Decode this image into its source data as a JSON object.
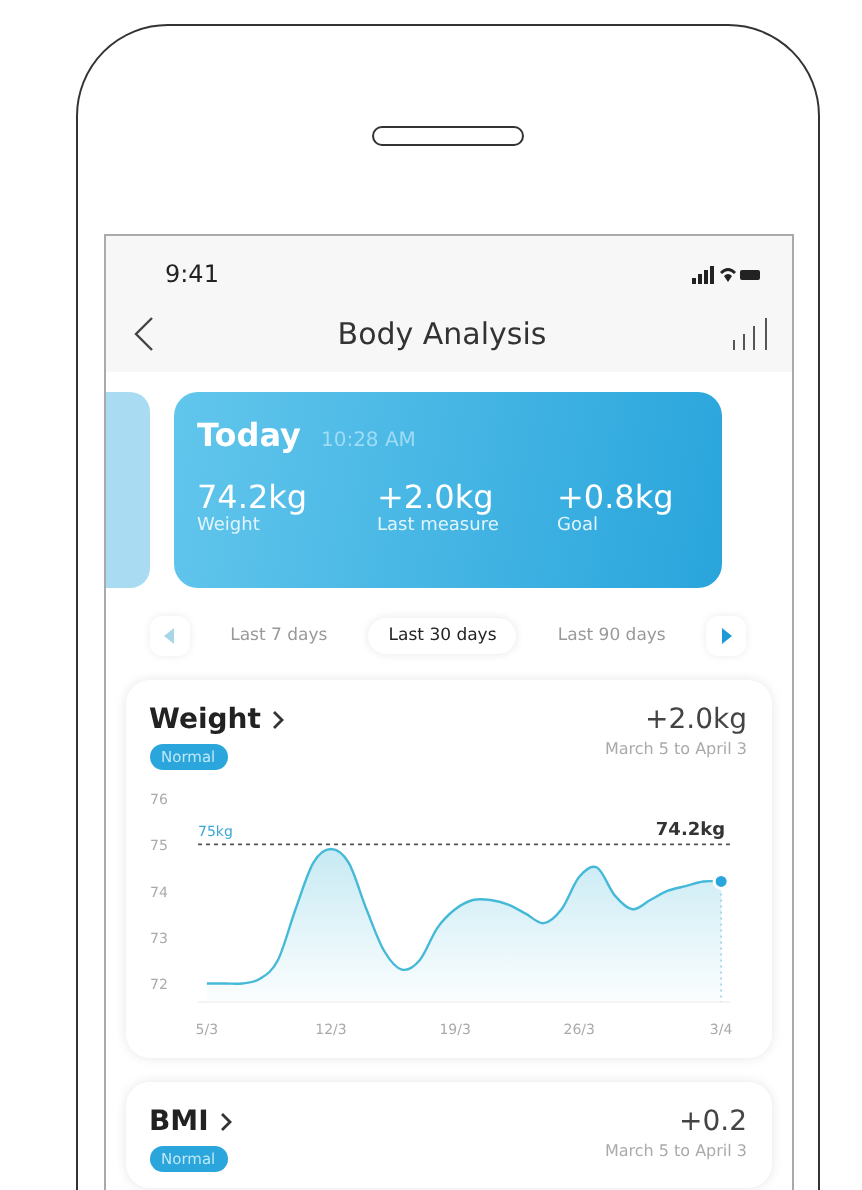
{
  "status_bar": {
    "time": "9:41"
  },
  "nav": {
    "title": "Body Analysis"
  },
  "summary": {
    "title": "Today",
    "time": "10:28 AM",
    "stats": [
      {
        "value": "74.2kg",
        "label": "Weight"
      },
      {
        "value": "+2.0kg",
        "label": "Last measure"
      },
      {
        "value": "+0.8kg",
        "label": "Goal"
      }
    ]
  },
  "periods": {
    "prev_disabled": true,
    "next_disabled": false,
    "items": [
      {
        "label": "Last 7 days",
        "selected": false
      },
      {
        "label": "Last 30 days",
        "selected": true
      },
      {
        "label": "Last 90 days",
        "selected": false
      }
    ]
  },
  "metrics": [
    {
      "title": "Weight",
      "badge": "Normal",
      "change": "+2.0kg",
      "range": "March 5 to April 3",
      "chart_data": {
        "type": "area",
        "categories": [
          "5/3",
          null,
          null,
          null,
          null,
          null,
          null,
          "12/3",
          null,
          null,
          null,
          null,
          null,
          null,
          "19/3",
          null,
          null,
          null,
          null,
          null,
          null,
          "26/3",
          null,
          null,
          null,
          null,
          null,
          null,
          null,
          "3/4"
        ],
        "series": [
          {
            "color": "#45b9d8",
            "values": [
              72,
              72,
              72,
              72.1,
              72.5,
              73.6,
              74.6,
              74.9,
              74.6,
              73.6,
              72.7,
              72.3,
              72.5,
              73.2,
              73.6,
              73.8,
              73.8,
              73.7,
              73.5,
              73.3,
              73.6,
              74.3,
              74.5,
              73.9,
              73.6,
              73.8,
              74,
              74.1,
              74.2,
              74.2
            ]
          }
        ],
        "ylim": [
          71.6,
          76
        ],
        "yticks": [
          72,
          73,
          74,
          75,
          76
        ],
        "annotations": [
          "75kg",
          {
            "y": 74.2,
            "text": "74.2kg"
          }
        ]
      }
    },
    {
      "title": "BMI",
      "badge": "Normal",
      "change": "+0.2",
      "range": "March 5 to April 3"
    }
  ]
}
